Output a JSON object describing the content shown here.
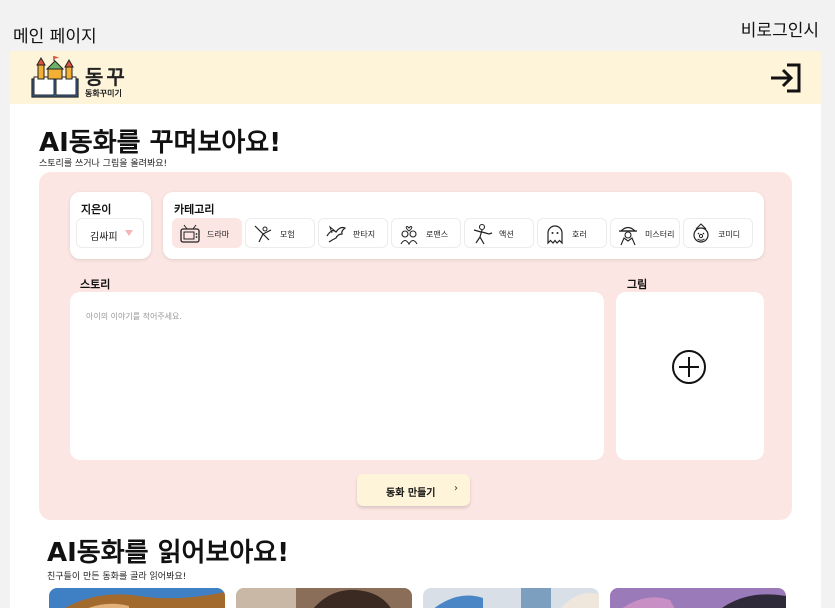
{
  "nav": {
    "main_page": "메인 페이지",
    "non_login": "비로그인시"
  },
  "header": {
    "logo_text": "동꾸",
    "logo_sub": "동화꾸미기",
    "login_icon": "login-arrow-icon"
  },
  "create": {
    "title": "AI동화를 꾸며보아요!",
    "subtitle": "스토리를 쓰거나 그림을 올려봐요!",
    "author": {
      "label": "지은이",
      "value": "김싸피"
    },
    "category": {
      "label": "카테고리",
      "items": [
        {
          "label": "드라마",
          "icon": "tv-icon",
          "active": true
        },
        {
          "label": "모험",
          "icon": "adventure-icon",
          "active": false
        },
        {
          "label": "판타지",
          "icon": "dragon-icon",
          "active": false
        },
        {
          "label": "로맨스",
          "icon": "romance-icon",
          "active": false
        },
        {
          "label": "액션",
          "icon": "action-icon",
          "active": false
        },
        {
          "label": "호러",
          "icon": "ghost-icon",
          "active": false
        },
        {
          "label": "미스터리",
          "icon": "detective-icon",
          "active": false
        },
        {
          "label": "코미디",
          "icon": "clown-icon",
          "active": false
        }
      ]
    },
    "story": {
      "label": "스토리",
      "placeholder": "아이의 이야기를 적어주세요."
    },
    "picture": {
      "label": "그림",
      "icon": "add-circle-icon"
    },
    "make_button": "동화 만들기"
  },
  "read": {
    "title": "AI동화를 읽어보아요!",
    "subtitle": "친구들이 만든 동화를 골라 읽어봐요!"
  },
  "colors": {
    "header_bg": "#fdf4d9",
    "panel_bg": "#fce6e3",
    "button_bg": "#fdf4d9"
  }
}
